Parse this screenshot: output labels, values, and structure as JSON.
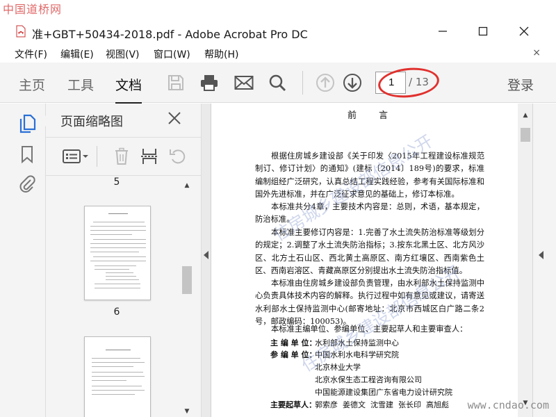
{
  "watermark_top": "中国道桥网",
  "window": {
    "title": "准+GBT+50434-2018.pdf - Adobe Acrobat Pro DC"
  },
  "menu": {
    "file": "文件(F)",
    "edit": "编辑(E)",
    "view": "视图(V)",
    "window": "窗口(W)",
    "help": "帮助(H)",
    "close": "×"
  },
  "tabs": {
    "home": "主页",
    "tools": "工具",
    "document": "文档"
  },
  "toolbar": {
    "page_current": "1",
    "page_total": "/ 13",
    "login": "登录"
  },
  "panel": {
    "title": "页面缩略图",
    "thumb_top_num": "5",
    "thumb_num": "6"
  },
  "document": {
    "heading": "前言",
    "paragraphs": [
      "根据住房城乡建设部《关于印发〈2015年工程建设标准规范制订、修订计划〉的通知》(建标〔2014〕189号)的要求，标准编制组经广泛研究，认真总结工程实践经验，参考有关国际标准和国外先进标准，并在广泛征求意见的基础上，修订本标准。",
      "本标准共分4章，主要技术内容是：总则，术语，基本规定，防治标准。",
      "本标准主要修订内容是：1.完善了水土流失防治标准等级划分的规定；2.调整了水土流失防治指标；3.按东北黑土区、北方风沙区、北方土石山区、西北黄土高原区、南方红壤区、西南紫色土区、西南岩溶区、青藏高原区分别提出水土流失防治指标值。",
      "本标准由住房城乡建设部负责管理，由水利部水土保持监测中心负责具体技术内容的解释。执行过程中如有意见或建议，请寄送水利部水土保持监测中心(邮寄地址：北京市西城区白广路二条2号，邮政编码：100053)。",
      "本标准主编单位、参编单位、主要起草人和主要审查人："
    ],
    "chief_label": "主 编 单 位：",
    "chief_value": "水利部水土保持监测中心",
    "participants_label": "参 编 单 位：",
    "participants": [
      "中国水利水电科学研究院",
      "北京林业大学",
      "北京水保生态工程咨询有限公司",
      "中国能源建设集团广东省电力设计研究院"
    ],
    "drafters_label": "主要起草人：",
    "drafters_value": "郭索彦  姜德文  沈雪建  张长印  高旭彪",
    "watermark_text": "住房城乡建设部信息公开"
  },
  "footer_watermark": "www.cndao.com",
  "colors": {
    "annotation_oval": "#e0312e",
    "toolbar_bg": "#f4f4f4",
    "icon_blue": "#2a6fd6"
  }
}
